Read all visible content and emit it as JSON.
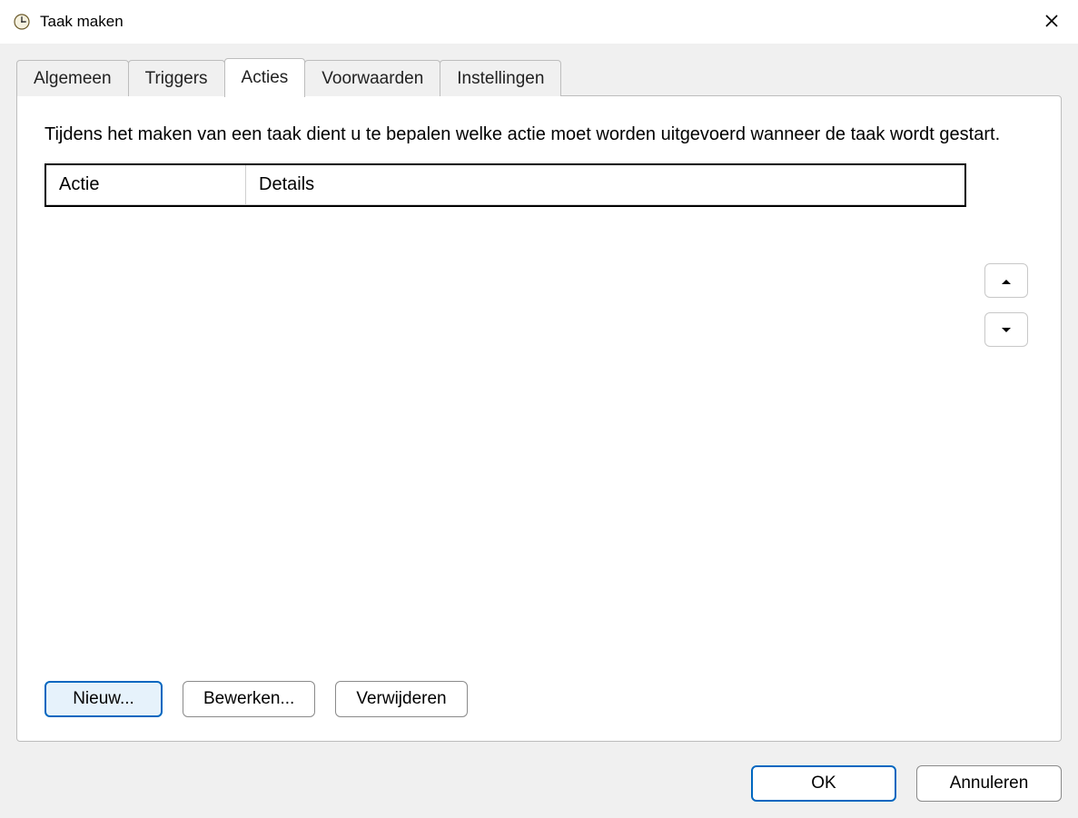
{
  "window": {
    "title": "Taak maken"
  },
  "tabs": {
    "items": [
      {
        "label": "Algemeen"
      },
      {
        "label": "Triggers"
      },
      {
        "label": "Acties"
      },
      {
        "label": "Voorwaarden"
      },
      {
        "label": "Instellingen"
      }
    ],
    "activeIndex": 2
  },
  "panel": {
    "description": "Tijdens het maken van een taak dient u te bepalen welke actie moet worden uitgevoerd wanneer de taak wordt gestart.",
    "columns": {
      "action": "Actie",
      "details": "Details"
    },
    "rows": [],
    "buttons": {
      "new": "Nieuw...",
      "edit": "Bewerken...",
      "delete": "Verwijderen"
    }
  },
  "footer": {
    "ok": "OK",
    "cancel": "Annuleren"
  }
}
